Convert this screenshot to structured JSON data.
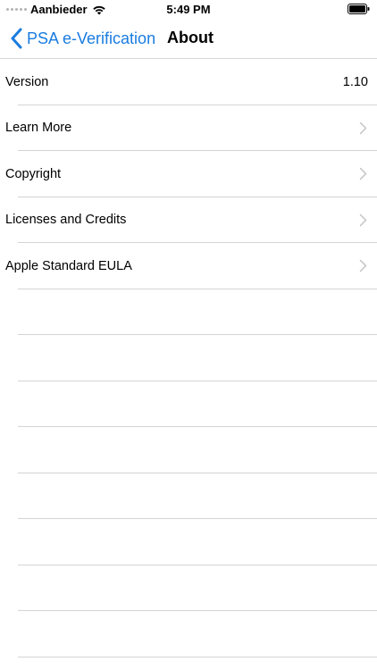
{
  "status_bar": {
    "carrier": "Aanbieder",
    "time": "5:49 PM"
  },
  "nav": {
    "back_label": "PSA e-Verification",
    "title": "About"
  },
  "rows": [
    {
      "label": "Version",
      "value": "1.10"
    },
    {
      "label": "Learn More"
    },
    {
      "label": "Copyright"
    },
    {
      "label": "Licenses and Credits"
    },
    {
      "label": "Apple Standard EULA"
    }
  ],
  "colors": {
    "accent": "#1a7ce0",
    "separator": "#d4d4d4",
    "chevron": "#c4c4c7"
  }
}
